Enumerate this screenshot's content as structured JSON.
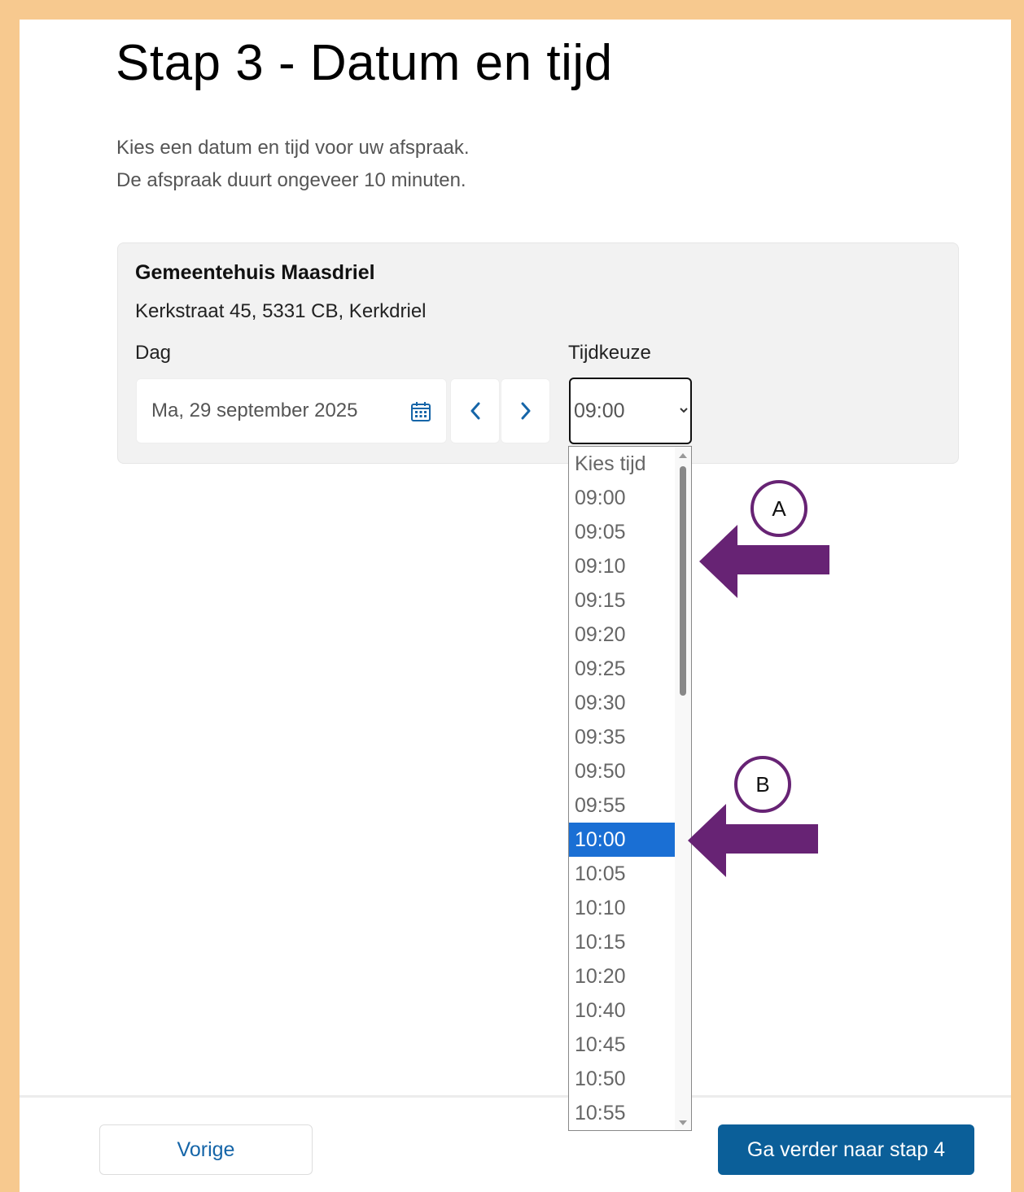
{
  "page": {
    "title": "Stap 3 - Datum en tijd",
    "intro_line1": "Kies een datum en tijd voor uw afspraak.",
    "intro_line2": "De afspraak duurt ongeveer 10 minuten."
  },
  "location": {
    "name": "Gemeentehuis Maasdriel",
    "address": "Kerkstraat 45, 5331 CB, Kerkdriel"
  },
  "date_picker": {
    "label": "Dag",
    "value": "Ma, 29 september 2025",
    "icon": "calendar-icon"
  },
  "time_select": {
    "label": "Tijdkeuze",
    "value": "09:00",
    "options": [
      "Kies tijd",
      "09:00",
      "09:05",
      "09:10",
      "09:15",
      "09:20",
      "09:25",
      "09:30",
      "09:35",
      "09:50",
      "09:55",
      "10:00",
      "10:05",
      "10:10",
      "10:15",
      "10:20",
      "10:40",
      "10:45",
      "10:50",
      "10:55"
    ],
    "highlighted": "10:00"
  },
  "annotations": {
    "a": "A",
    "b": "B"
  },
  "footer": {
    "prev_label": "Vorige",
    "next_label": "Ga verder naar stap 4"
  },
  "colors": {
    "frame": "#f7c98f",
    "primary": "#0b5f99",
    "link": "#1565a8",
    "highlight": "#1a6fd4",
    "annotation": "#672374"
  }
}
